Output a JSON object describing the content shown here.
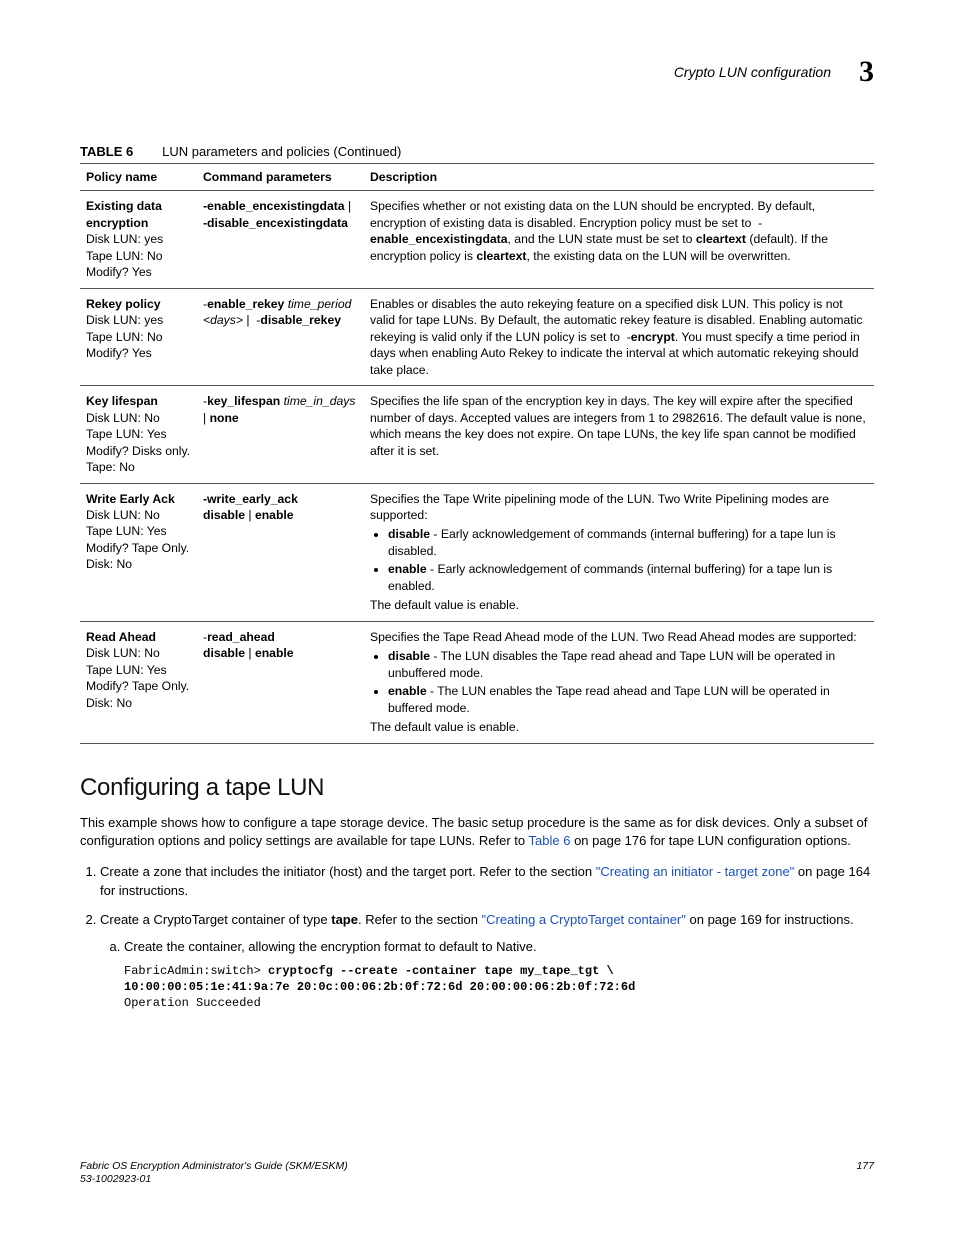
{
  "header": {
    "title": "Crypto LUN configuration",
    "chapter": "3"
  },
  "table": {
    "label": "TABLE 6",
    "caption": "LUN parameters and policies  (Continued)",
    "head": {
      "c1": "Policy name",
      "c2": "Command parameters",
      "c3": "Description"
    },
    "rows": {
      "r0": {
        "pname": "Existing data encryption",
        "sub1": "Disk LUN: yes",
        "sub2": "Tape LUN: No",
        "sub3": "Modify? Yes",
        "cparam_html": "<b>-enable_encexistingdata</b> | <b>-disable_encexistingdata</b>",
        "desc_html": "Specifies whether or not existing data on the LUN should be encrypted. By default, encryption of existing data is disabled. Encryption policy must be set to &nbsp;-<b>enable_encexistingdata</b>, and the LUN state must be set to <b>cleartext</b> (default). If the encryption policy is <b>cleartext</b>, the existing data on the LUN will be overwritten."
      },
      "r1": {
        "pname": "Rekey policy",
        "sub1": "Disk LUN: yes",
        "sub2": "Tape LUN: No",
        "sub3": "Modify? Yes",
        "cparam_html": "-<b>enable_rekey</b> <i>time_period &lt;days&gt;</i> | &nbsp;-<b>disable_rekey</b>",
        "desc_html": "Enables or disables the auto rekeying feature on a specified disk LUN. This policy is not valid for tape LUNs. By Default, the automatic rekey feature is disabled. Enabling automatic rekeying is valid only if the LUN policy is set to &nbsp;-<b>encrypt</b>. You must specify a time period in days when enabling Auto Rekey to indicate the interval at which automatic rekeying should take place."
      },
      "r2": {
        "pname": "Key lifespan",
        "sub1": "Disk LUN: No",
        "sub2": "Tape LUN: Yes",
        "sub3": "Modify? Disks only. Tape: No",
        "cparam_html": "-<b>key_lifespan</b> <i>time_in_days</i> | <b>none</b>",
        "desc_html": "Specifies the life span of the encryption key in days. The key will expire after the specified number of days. Accepted values are integers from 1 to 2982616. The default value is none, which means the key does not expire. On tape LUNs, the key life span cannot be modified after it is set."
      },
      "r3": {
        "pname": "Write Early Ack",
        "sub1": "Disk LUN: No",
        "sub2": "Tape LUN: Yes",
        "sub3": "Modify? Tape Only. Disk: No",
        "cparam_html": "<b>-write_early_ack</b><br><b>disable</b> | <b>enable</b>",
        "desc_pre": "Specifies the Tape Write pipelining mode of the LUN. Two Write Pipelining modes are supported:",
        "b1": "disable",
        "b1t": " - Early acknowledgement of commands (internal buffering) for a tape lun is disabled.",
        "b2": "enable",
        "b2t": " - Early acknowledgement of commands (internal buffering) for a tape lun is enabled.",
        "desc_post": "The default value is enable."
      },
      "r4": {
        "pname": "Read Ahead",
        "sub1": "Disk LUN: No",
        "sub2": "Tape LUN: Yes",
        "sub3": "Modify? Tape Only. Disk: No",
        "cparam_html": "-<b>read_ahead</b><br><b>disable</b> | <b>enable</b>",
        "desc_pre": "Specifies the Tape Read Ahead mode of the LUN. Two Read Ahead modes are supported:",
        "b1": "disable",
        "b1t": " - The LUN disables the Tape read ahead and Tape LUN will be operated in unbuffered mode.",
        "b2": "enable",
        "b2t": " - The LUN enables the Tape read ahead and Tape LUN will be operated in buffered mode.",
        "desc_post": "The default value is enable."
      }
    }
  },
  "section": {
    "title": "Configuring a tape LUN",
    "intro_pre": "This example shows how to configure a tape storage device. The basic setup procedure is the same as for disk devices. Only a subset of configuration options and policy settings are available for tape LUNs. Refer to ",
    "intro_link": "Table 6",
    "intro_post": " on page 176 for tape LUN configuration options.",
    "step1a": "Create a zone that includes the initiator (host) and the target port. Refer to the section ",
    "step1link": "\"Creating an initiator - target zone\"",
    "step1b": " on page 164 for instructions.",
    "step2a": "Create a CryptoTarget container of type ",
    "step2bold": "tape",
    "step2b": ". Refer to the section ",
    "step2link": "\"Creating a CryptoTarget container\"",
    "step2c": " on page 169 for instructions.",
    "step2sub": "Create the container, allowing the encryption format to default to Native.",
    "code_prompt": "FabricAdmin:switch> ",
    "code_cmd": "cryptocfg --create -container tape my_tape_tgt \\\n10:00:00:05:1e:41:9a:7e 20:0c:00:06:2b:0f:72:6d 20:00:00:06:2b:0f:72:6d",
    "code_result": "Operation Succeeded"
  },
  "footer": {
    "left1": "Fabric OS Encryption Administrator's Guide (SKM/ESKM)",
    "left2": "53-1002923-01",
    "right": "177"
  }
}
